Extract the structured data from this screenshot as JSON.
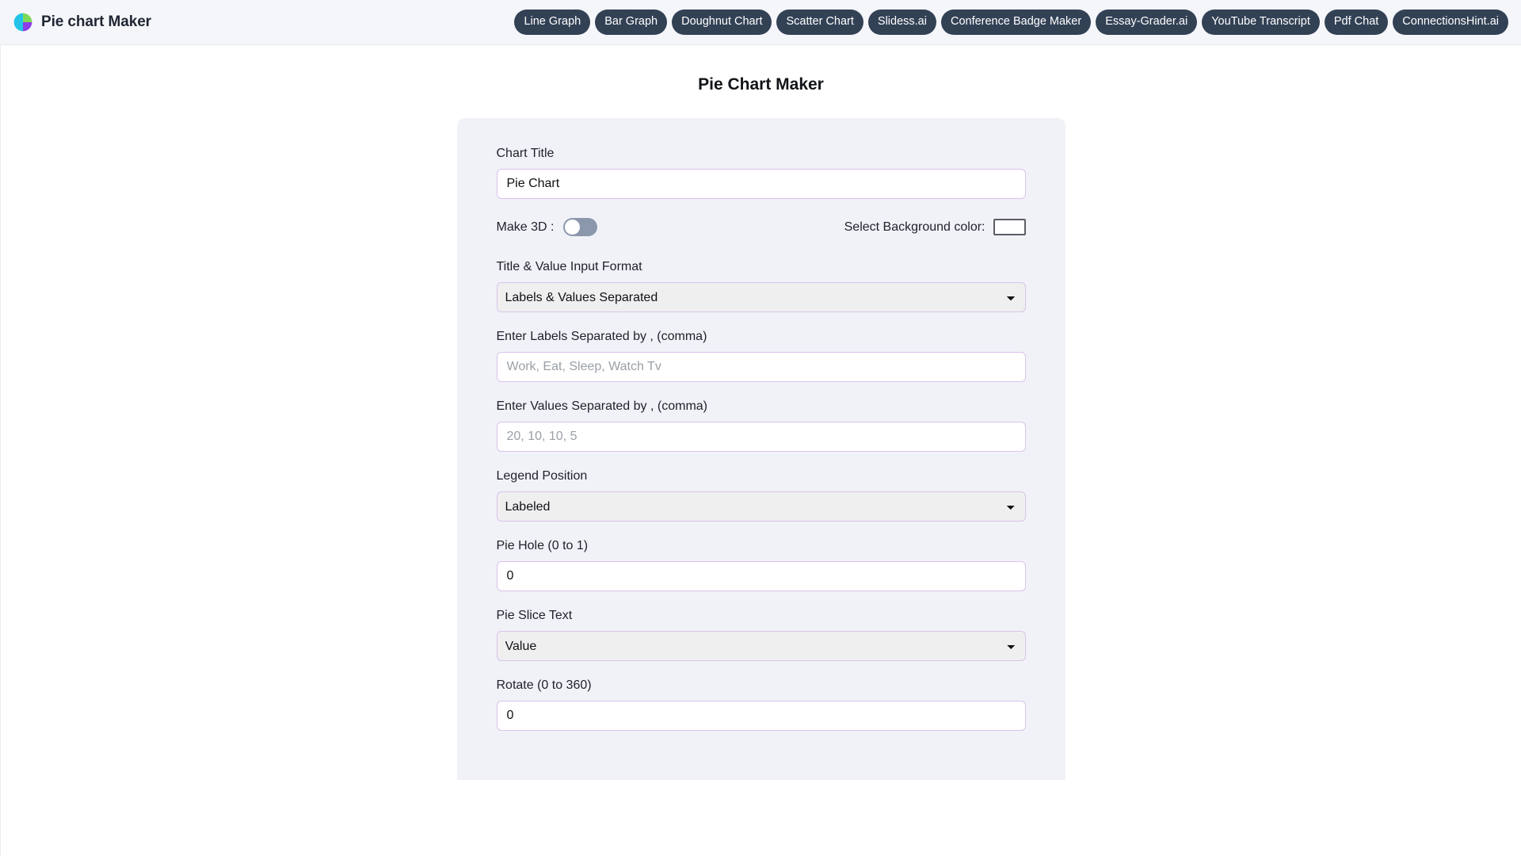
{
  "header": {
    "brand_title": "Pie chart Maker",
    "logo_icon": "pie-chart-logo-icon",
    "nav_items": [
      {
        "label": "Line Graph",
        "name": "line-graph"
      },
      {
        "label": "Bar Graph",
        "name": "bar-graph"
      },
      {
        "label": "Doughnut Chart",
        "name": "doughnut-chart"
      },
      {
        "label": "Scatter Chart",
        "name": "scatter-chart"
      },
      {
        "label": "Slidess.ai",
        "name": "slidess-ai"
      },
      {
        "label": "Conference Badge Maker",
        "name": "conference-badge-maker"
      },
      {
        "label": "Essay-Grader.ai",
        "name": "essay-grader-ai"
      },
      {
        "label": "YouTube Transcript",
        "name": "youtube-transcript"
      },
      {
        "label": "Pdf Chat",
        "name": "pdf-chat"
      },
      {
        "label": "ConnectionsHint.ai",
        "name": "connectionshint-ai"
      }
    ]
  },
  "main": {
    "page_title": "Pie Chart Maker",
    "chart_title": {
      "label": "Chart Title",
      "value": "Pie Chart",
      "placeholder": "Pie Chart"
    },
    "make_3d": {
      "label": "Make 3D :",
      "state": "off"
    },
    "background_color": {
      "label": "Select Background color:",
      "value": "#ffffff"
    },
    "input_format": {
      "label": "Title & Value Input Format",
      "selected": "Labels & Values Separated",
      "options": [
        "Labels & Values Separated"
      ]
    },
    "labels_input": {
      "label": "Enter Labels Separated by , (comma)",
      "value": "",
      "placeholder": "Work, Eat, Sleep, Watch Tv"
    },
    "values_input": {
      "label": "Enter Values Separated by , (comma)",
      "value": "",
      "placeholder": "20, 10, 10, 5"
    },
    "legend_position": {
      "label": "Legend Position",
      "selected": "Labeled",
      "options": [
        "Labeled"
      ]
    },
    "pie_hole": {
      "label": "Pie Hole (0 to 1)",
      "value": "0"
    },
    "pie_slice_text": {
      "label": "Pie Slice Text",
      "selected": "Value",
      "options": [
        "Value"
      ]
    },
    "rotate": {
      "label": "Rotate (0 to 360)",
      "value": "0"
    }
  },
  "colors": {
    "nav_pill_bg": "#334155",
    "header_bg": "#f5f6fa",
    "card_bg": "#f1f2f7",
    "input_border": "#d9c3ea",
    "select_bg": "#efeff0",
    "toggle_off": "#8b97ab"
  }
}
